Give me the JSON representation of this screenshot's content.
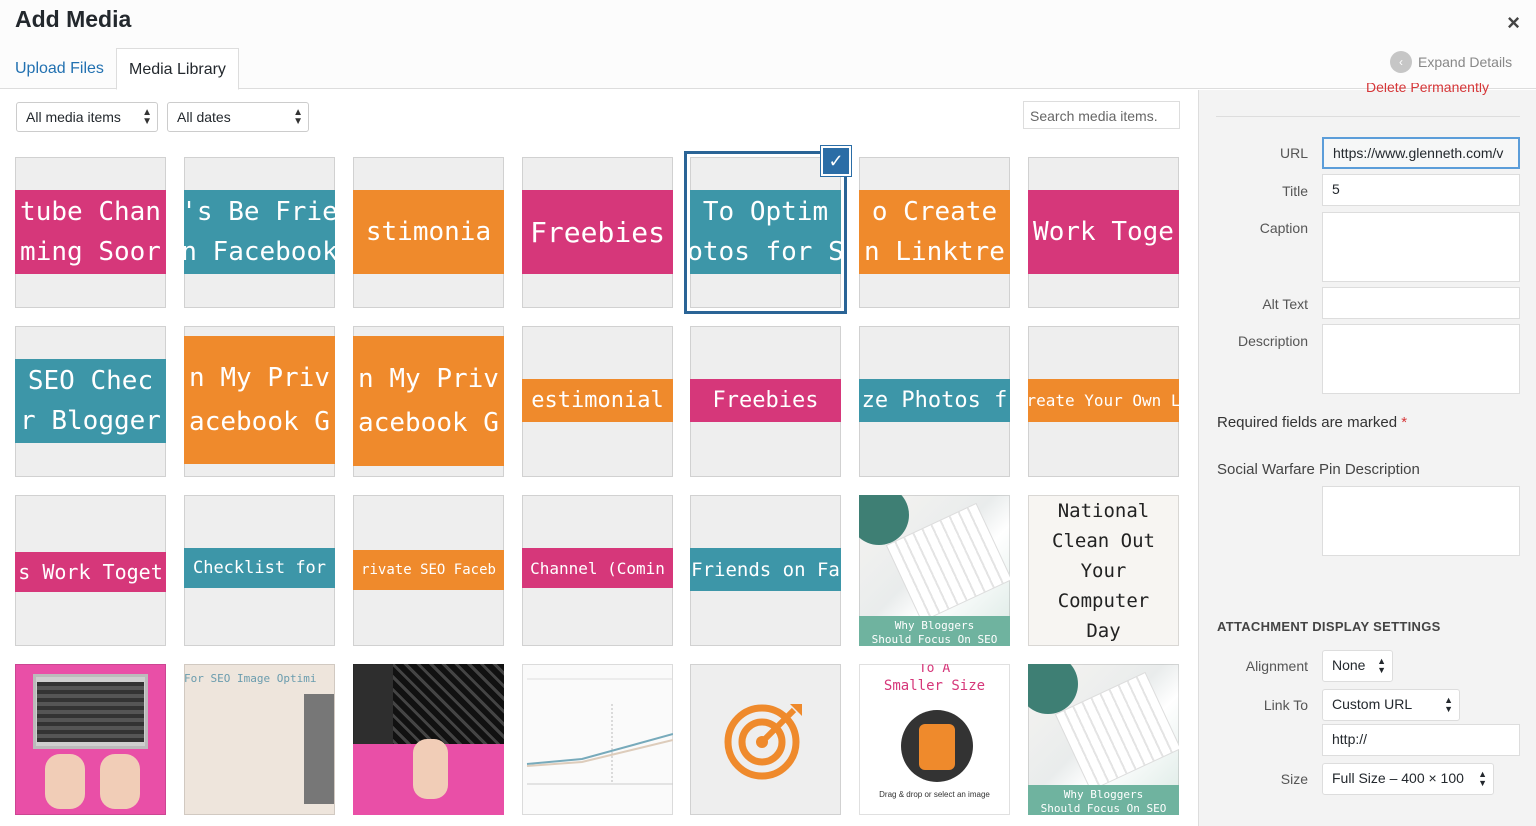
{
  "modal": {
    "title": "Add Media",
    "close": "×",
    "tab_upload": "Upload Files",
    "tab_library": "Media Library",
    "expand": "Expand Details"
  },
  "filters": {
    "type": "All media items",
    "dates": "All dates",
    "search_placeholder": "Search media items."
  },
  "grid": {
    "r1": [
      "tube Chan",
      "ming Soor",
      "'s Be Frie",
      "n Facebook",
      "stimonia",
      "Freebies",
      "To Optim",
      "otos for S",
      "o Create",
      "n Linktre",
      "Work Toge"
    ],
    "r2": [
      "SEO Chec",
      "r Blogger",
      "n My Priv",
      "acebook G",
      "n My Priv",
      "acebook G",
      "estimonial",
      "Freebies",
      "ze Photos f",
      "reate Your Own L"
    ],
    "r3": [
      "s Work Toget",
      "Checklist for",
      "rivate SEO Faceb",
      "Channel (Comin",
      "Friends on Fa",
      "Why Bloggers",
      "Should Focus On SEO",
      "National",
      "Clean Out",
      "Your",
      "Computer",
      "Day"
    ],
    "r4": [
      "For SEO Image Optimi",
      "To A",
      "Smaller Size",
      "Drag & drop or select an image",
      "Why Bloggers",
      "Should Focus On SEO"
    ]
  },
  "details": {
    "delete": "Delete Permanently",
    "url_label": "URL",
    "url_value": "https://www.glenneth.com/v",
    "title_label": "Title",
    "title_value": "5",
    "caption_label": "Caption",
    "alt_label": "Alt Text",
    "desc_label": "Description",
    "required": "Required fields are marked",
    "req_star": "*",
    "swp_label": "Social Warfare Pin Description"
  },
  "display": {
    "heading": "ATTACHMENT DISPLAY SETTINGS",
    "align_label": "Alignment",
    "align_value": "None",
    "link_label": "Link To",
    "link_value": "Custom URL",
    "link_url": "http://",
    "size_label": "Size",
    "size_value": "Full Size – 400 × 100"
  },
  "colors": {
    "accent": "#2271b1",
    "pink": "#d6377a",
    "teal": "#3d96a8",
    "orange": "#ef8a2c",
    "delete": "#d63638"
  }
}
